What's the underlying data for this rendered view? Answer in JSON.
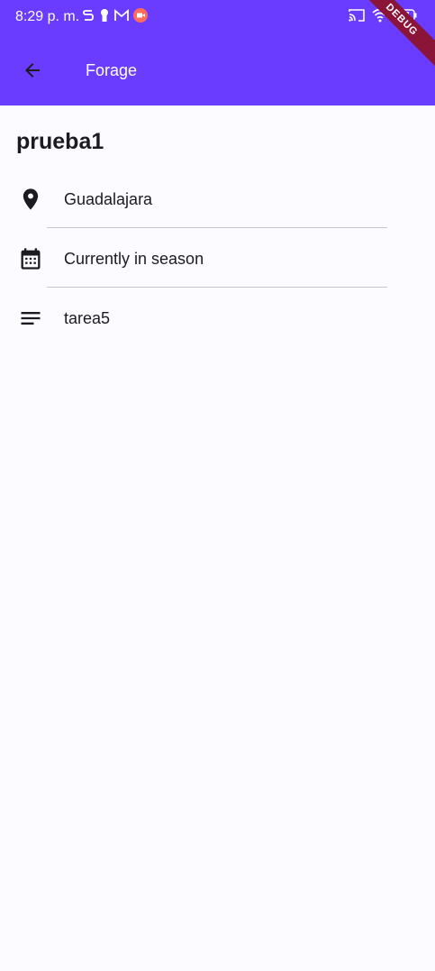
{
  "status_bar": {
    "time": "8:29 p. m.",
    "icons_left": [
      "s-icon",
      "keyhole-icon",
      "gmail-icon",
      "record-icon"
    ],
    "icons_right": [
      "cast-icon",
      "wifi-icon",
      "battery-icon"
    ]
  },
  "app_bar": {
    "title": "Forage",
    "back_icon": "arrow-back-icon",
    "color": "#6a3cff"
  },
  "debug_banner": "DEBUG",
  "detail": {
    "title": "prueba1",
    "items": [
      {
        "icon": "location-pin-icon",
        "text": "Guadalajara"
      },
      {
        "icon": "calendar-icon",
        "text": "Currently in season"
      },
      {
        "icon": "notes-icon",
        "text": "tarea5"
      }
    ]
  }
}
